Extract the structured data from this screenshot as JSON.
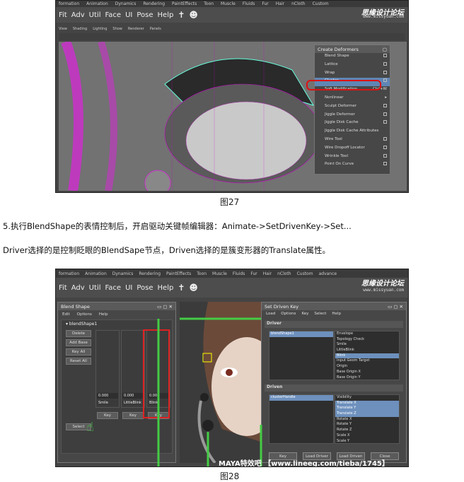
{
  "shot1": {
    "menubar": [
      "formation",
      "Animation",
      "Dynamics",
      "Rendering",
      "PaintEffects",
      "Toon",
      "Muscle",
      "Fluids",
      "Fur",
      "Hair",
      "nCloth",
      "Custom"
    ],
    "shelf": [
      "Fit",
      "Adv",
      "Util",
      "Face",
      "UI",
      "Pose",
      "Help"
    ],
    "viewmenu": [
      "View",
      "Shading",
      "Lighting",
      "Show",
      "Renderer",
      "Panels"
    ],
    "logo": "思缘设计论坛",
    "logo_url": "www.missyuan.com",
    "deformers_title": "Create Deformers",
    "deformers": [
      {
        "label": "Blend Shape",
        "opt": true
      },
      {
        "label": "Lattice",
        "opt": true
      },
      {
        "label": "Wrap",
        "opt": true
      },
      {
        "label": "Cluster",
        "opt": true,
        "selected": true
      },
      {
        "label": "Soft Modification",
        "shortcut": "Ctrl+W"
      },
      {
        "label": "Nonlinear",
        "arrow": true
      },
      {
        "label": "Sculpt Deformer",
        "opt": true
      },
      {
        "label": "Jiggle Deformer",
        "opt": true
      },
      {
        "label": "Jiggle Disk Cache",
        "opt": true
      },
      {
        "label": "Jiggle Disk Cache Attributes"
      },
      {
        "label": "Wire Tool",
        "opt": true
      },
      {
        "label": "Wire Dropoff Locator",
        "opt": true
      },
      {
        "label": "Wrinkle Tool",
        "opt": true
      },
      {
        "label": "Point On Curve",
        "opt": true
      }
    ],
    "caption": "图27"
  },
  "text": {
    "line1": "5.执行BlendShape的表情控制后，开启驱动关键帧编辑器：Animate->SetDrivenKey->Set...",
    "line2": "Driver选择的是控制眨眼的BlendSape节点，Driven选择的是簇变形器的Translate属性。"
  },
  "shot2": {
    "menubar": [
      "formation",
      "Animation",
      "Dynamics",
      "Rendering",
      "PaintEffects",
      "Toon",
      "Muscle",
      "Fluids",
      "Fur",
      "Hair",
      "nCloth",
      "Custom",
      "advance"
    ],
    "shelf": [
      "Fit",
      "Adv",
      "Util",
      "Face",
      "UI",
      "Pose",
      "Help"
    ],
    "logo": "思缘设计论坛",
    "logo_url": "www.missyuan.com",
    "blendshape": {
      "title": "Blend Shape",
      "menu": [
        "Edit",
        "Options",
        "Help"
      ],
      "node": "blendShape1",
      "buttons": [
        "Delete",
        "Add Base",
        "Key All",
        "Reset All"
      ],
      "sliders": [
        {
          "value": "0.000",
          "name": "Smile"
        },
        {
          "value": "0.000",
          "name": "LittleBlink"
        },
        {
          "value": "0.000",
          "name": "Blink"
        }
      ],
      "key": "Key",
      "select": "Select"
    },
    "sdk": {
      "title": "Set Driven Key",
      "menu": [
        "Load",
        "Options",
        "Key",
        "Select",
        "Help"
      ],
      "driver_label": "Driver",
      "driven_label": "Driven",
      "driver_node": "blendShape1",
      "driver_attrs": [
        "Envelope",
        "Topology Check",
        "Smile",
        "LittleBlink",
        "Blink",
        "Input Geom Target",
        "Origin",
        "Base Origin X",
        "Base Origin Y"
      ],
      "driven_node": "clusterHandle",
      "driven_attrs": [
        "Visibility",
        "Translate X",
        "Translate Y",
        "Translate Z",
        "Rotate X",
        "Rotate Y",
        "Rotate Z",
        "Scale X",
        "Scale Y"
      ],
      "buttons": [
        "Key",
        "Load Driver",
        "Load Driven",
        "Close"
      ]
    },
    "watermark": "MAYA特效吧 【www.lineeg.com/tieba/1745】",
    "caption": "图28"
  }
}
